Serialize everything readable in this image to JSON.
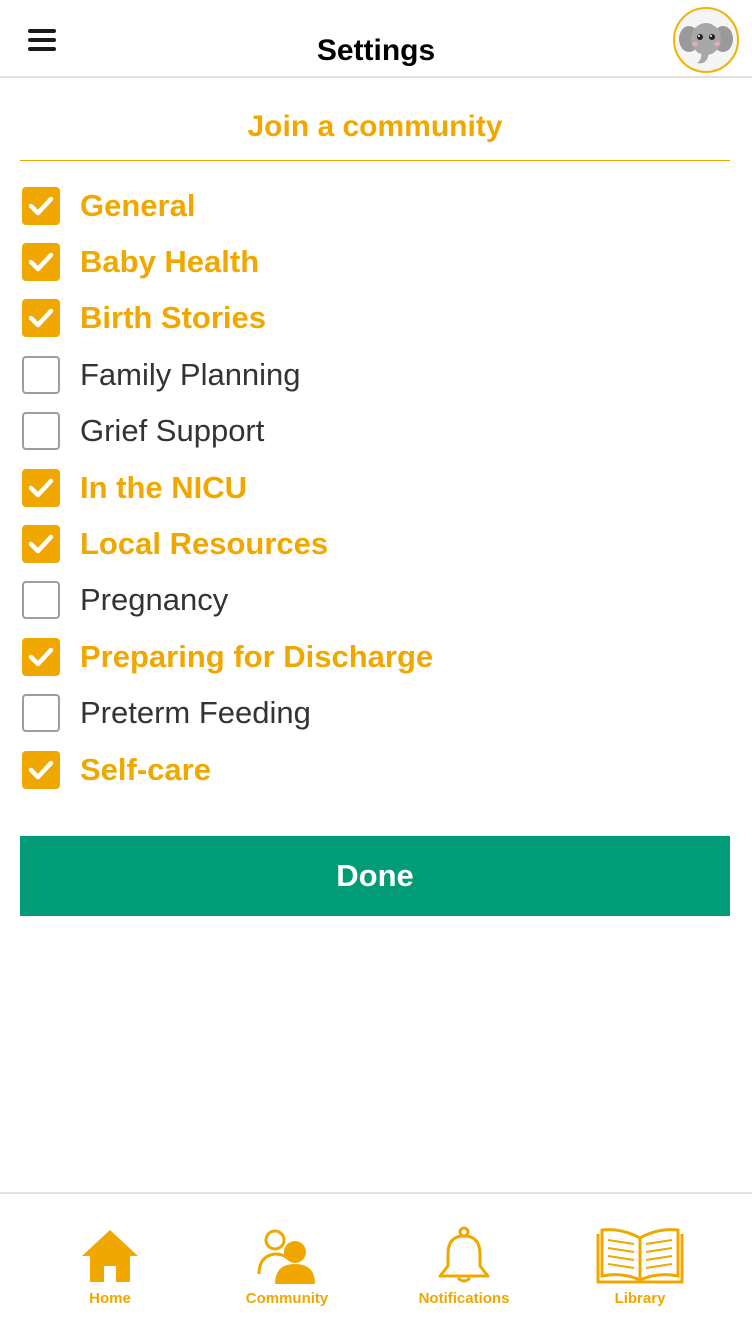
{
  "header": {
    "title": "Settings",
    "menu_icon": "hamburger-menu-icon",
    "avatar_icon": "elephant-avatar"
  },
  "section": {
    "title": "Join a community"
  },
  "communities": [
    {
      "label": "General",
      "checked": true
    },
    {
      "label": "Baby Health",
      "checked": true
    },
    {
      "label": "Birth Stories",
      "checked": true
    },
    {
      "label": "Family Planning",
      "checked": false
    },
    {
      "label": "Grief Support",
      "checked": false
    },
    {
      "label": "In the NICU",
      "checked": true
    },
    {
      "label": "Local Resources",
      "checked": true
    },
    {
      "label": "Pregnancy",
      "checked": false
    },
    {
      "label": "Preparing for Discharge",
      "checked": true
    },
    {
      "label": "Preterm Feeding",
      "checked": false
    },
    {
      "label": "Self-care",
      "checked": true
    }
  ],
  "done_label": "Done",
  "tabs": [
    {
      "label": "Home",
      "icon": "home-icon"
    },
    {
      "label": "Community",
      "icon": "community-icon"
    },
    {
      "label": "Notifications",
      "icon": "bell-icon"
    },
    {
      "label": "Library",
      "icon": "book-icon"
    }
  ],
  "colors": {
    "accent": "#f0a800",
    "primary_button": "#009b77",
    "unchecked_text": "#333333"
  }
}
